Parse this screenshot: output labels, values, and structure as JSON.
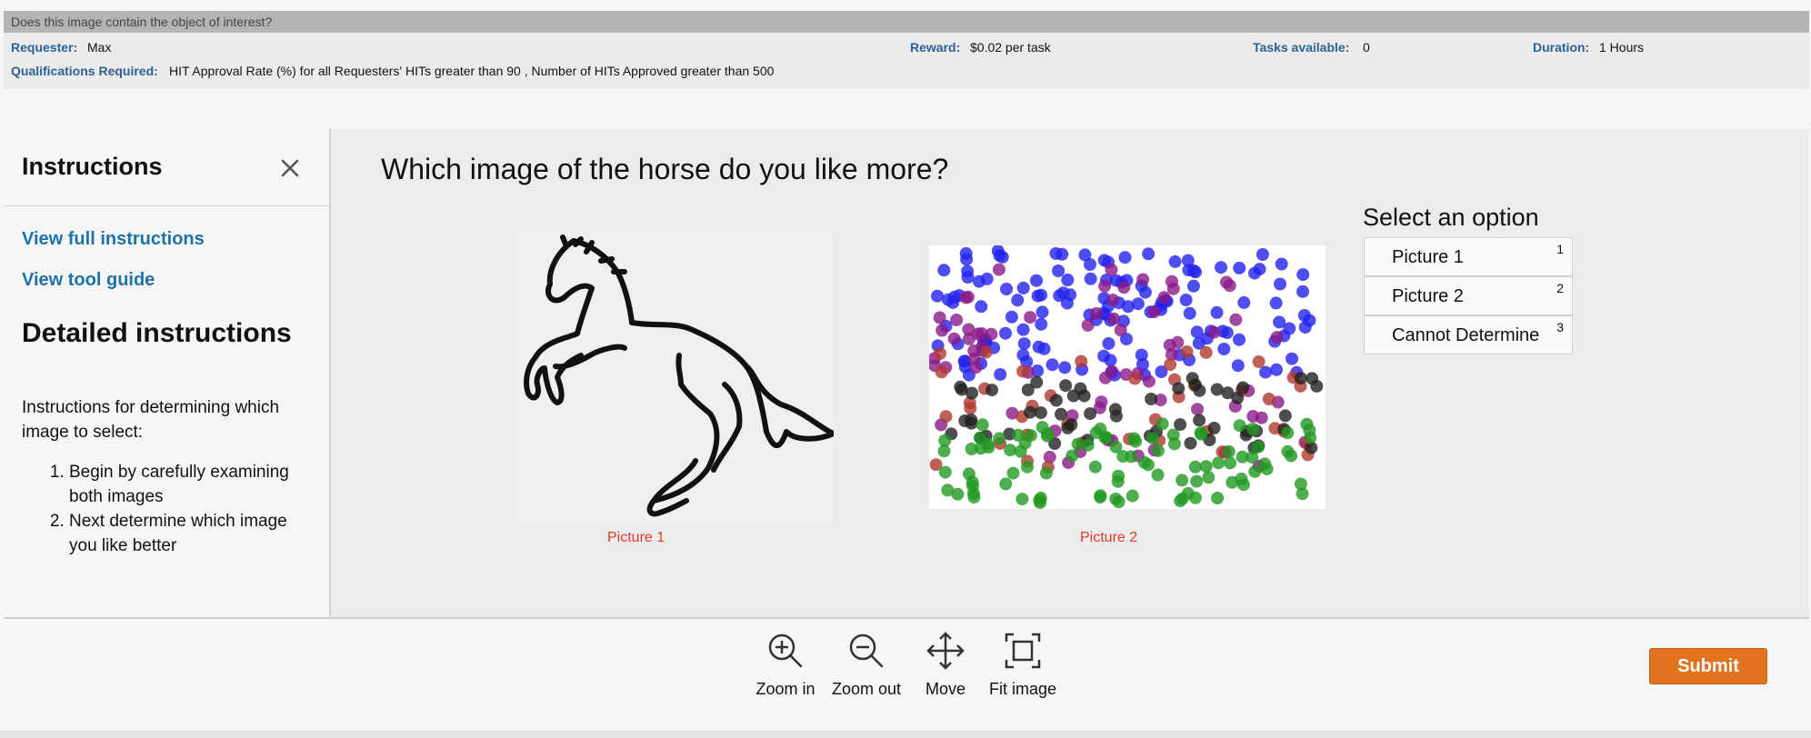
{
  "header": {
    "title": "Does this image contain the object of interest?",
    "requester_label": "Requester:",
    "requester_value": "Max",
    "reward_label": "Reward:",
    "reward_value": "$0.02 per task",
    "tasks_label": "Tasks available:",
    "tasks_value": "0",
    "duration_label": "Duration:",
    "duration_value": "1 Hours",
    "qualifications_label": "Qualifications Required:",
    "qualifications_value": "HIT Approval Rate (%) for all Requesters' HITs greater than 90 , Number of HITs Approved greater than 500"
  },
  "instructions": {
    "heading": "Instructions",
    "close_icon": "close-icon",
    "view_full_label": "View full instructions",
    "view_tool_guide_label": "View tool guide",
    "detailed_heading": "Detailed instructions",
    "intro": "Instructions for determining which image to select:",
    "steps": [
      "Begin by carefully examining both images",
      "Next determine which image you like better"
    ]
  },
  "task": {
    "question": "Which image of the horse do you like more?",
    "picture1_caption": "Picture 1",
    "picture2_caption": "Picture 2",
    "select_heading": "Select an option",
    "options": [
      {
        "label": "Picture 1",
        "key": "1"
      },
      {
        "label": "Picture 2",
        "key": "2"
      },
      {
        "label": "Cannot Determine",
        "key": "3"
      }
    ]
  },
  "toolbar": {
    "tools": [
      {
        "label": "Zoom in",
        "icon": "zoom-in-icon"
      },
      {
        "label": "Zoom out",
        "icon": "zoom-out-icon"
      },
      {
        "label": "Move",
        "icon": "move-icon"
      },
      {
        "label": "Fit image",
        "icon": "fit-image-icon"
      }
    ],
    "submit_label": "Submit"
  },
  "colors": {
    "accent": "#e1731f",
    "link": "#1f72a8",
    "caption": "#e5382b",
    "header_label": "#2e5f95",
    "dot_blue": "#2323ee",
    "dot_purple": "#8a1a8a",
    "dot_red": "#b03a30",
    "dot_black": "#222222",
    "dot_green": "#229922"
  }
}
